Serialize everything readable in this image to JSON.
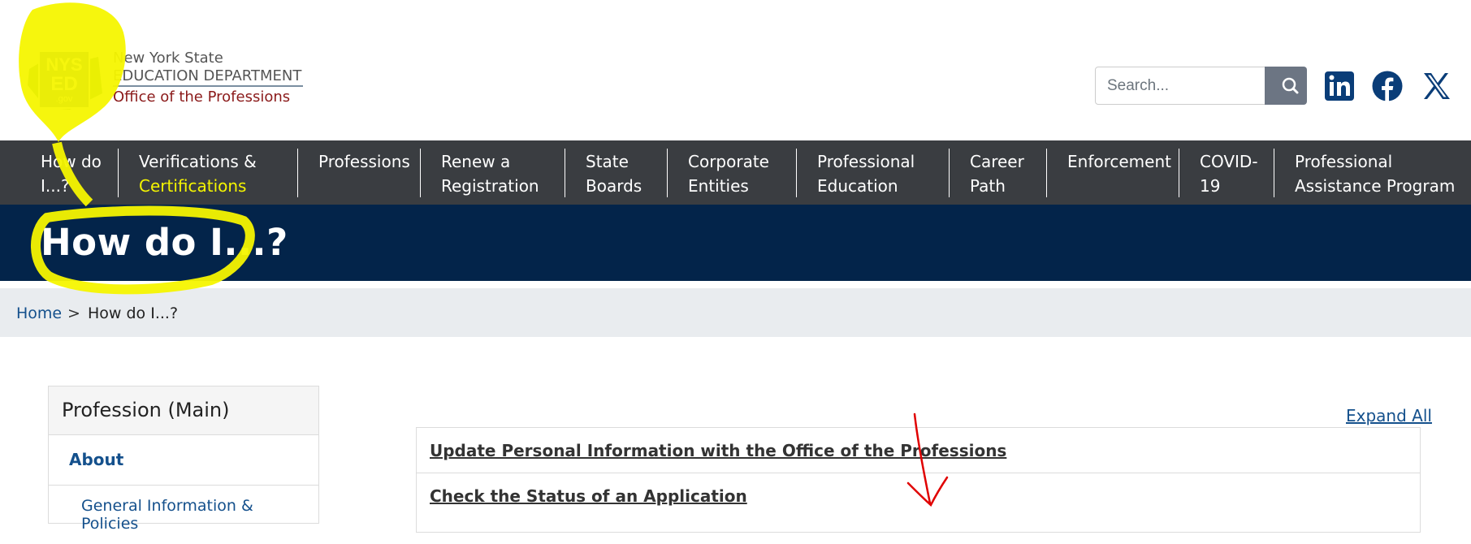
{
  "header": {
    "logo": {
      "badge_top": "NYS",
      "badge_mid": "ED",
      "badge_bottom": ".gov",
      "line1": "New York State",
      "line2": "EDUCATION DEPARTMENT",
      "line3": "Office of the Professions"
    },
    "search": {
      "placeholder": "Search..."
    },
    "social": [
      "linkedin-icon",
      "facebook-icon",
      "x-icon"
    ]
  },
  "nav": {
    "items": [
      {
        "label": "How do I...?"
      },
      {
        "label_part1": "Verifications & ",
        "label_part2": "Certifications"
      },
      {
        "label": "Professions"
      },
      {
        "label": "Renew a Registration"
      },
      {
        "label": "State Boards"
      },
      {
        "label": "Corporate Entities"
      },
      {
        "label": "Professional Education"
      },
      {
        "label": "Career Path"
      },
      {
        "label": "Enforcement"
      },
      {
        "label": "COVID-19"
      },
      {
        "label": "Professional Assistance Program"
      }
    ]
  },
  "banner": {
    "title": "How do I...?"
  },
  "breadcrumb": {
    "home": "Home",
    "separator": ">",
    "current": "How do I...?"
  },
  "sidebar": {
    "heading": "Profession (Main)",
    "about": "About",
    "sub_item": "General Information & Policies"
  },
  "main": {
    "expand_all": "Expand All",
    "accordion": [
      "Update Personal Information with the Office of the Professions",
      "Check the Status of an Application"
    ]
  },
  "colors": {
    "nav_bg": "#3a3d41",
    "banner_bg": "#03244a",
    "link": "#14508c",
    "highlight": "#f5f500",
    "annotation_red": "#e00000"
  }
}
